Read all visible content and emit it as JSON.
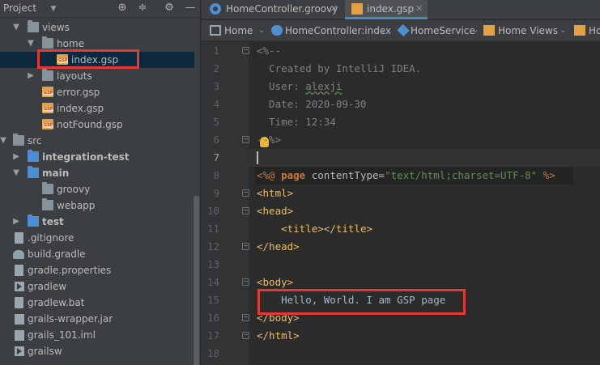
{
  "project_panel": {
    "title": "Project",
    "tree": [
      {
        "label": "views",
        "kind": "folder",
        "expanded": true
      },
      {
        "label": "home",
        "kind": "folder",
        "expanded": true
      },
      {
        "label": "index.gsp",
        "kind": "gsp",
        "selected": true,
        "highlighted": true
      },
      {
        "label": "layouts",
        "kind": "folder",
        "expanded": false
      },
      {
        "label": "error.gsp",
        "kind": "gsp"
      },
      {
        "label": "index.gsp",
        "kind": "gsp"
      },
      {
        "label": "notFound.gsp",
        "kind": "gsp"
      },
      {
        "label": "src",
        "kind": "folder",
        "expanded": true
      },
      {
        "label": "integration-test",
        "kind": "folder-src",
        "expanded": false,
        "bold": true
      },
      {
        "label": "main",
        "kind": "folder-src",
        "expanded": true,
        "bold": true
      },
      {
        "label": "groovy",
        "kind": "folder"
      },
      {
        "label": "webapp",
        "kind": "folder"
      },
      {
        "label": "test",
        "kind": "folder-src",
        "expanded": false,
        "bold": true
      },
      {
        "label": ".gitignore",
        "kind": "file"
      },
      {
        "label": "build.gradle",
        "kind": "gradle"
      },
      {
        "label": "gradle.properties",
        "kind": "file"
      },
      {
        "label": "gradlew",
        "kind": "exec"
      },
      {
        "label": "gradlew.bat",
        "kind": "file"
      },
      {
        "label": "grails-wrapper.jar",
        "kind": "jar"
      },
      {
        "label": "grails_101.iml",
        "kind": "iml"
      },
      {
        "label": "grailsw",
        "kind": "exec"
      }
    ]
  },
  "tabs": [
    {
      "label": "HomeController.groovy",
      "active": false
    },
    {
      "label": "index.gsp",
      "active": true
    }
  ],
  "breadcrumbs": [
    {
      "label": "Home"
    },
    {
      "label": "HomeController:index"
    },
    {
      "label": "HomeService"
    },
    {
      "label": "Home Views"
    },
    {
      "label": "Hom"
    }
  ],
  "line_numbers": [
    "1",
    "2",
    "3",
    "4",
    "5",
    "6",
    "7",
    "8",
    "9",
    "10",
    "11",
    "12",
    "13",
    "14",
    "15",
    "16",
    "17",
    "18"
  ],
  "code": {
    "l1": "<%--",
    "l2": "  Created by IntelliJ IDEA.",
    "l3a": "  User: ",
    "l3b": "alexji",
    "l4": "  Date: 2020-09-30",
    "l5": "  Time: 12:34",
    "l6": "--%>",
    "l8_open": "<%@ ",
    "l8_kw": "page",
    "l8_attr": " contentType=",
    "l8_val": "\"text/html;charset=UTF-8\"",
    "l8_close": " %>",
    "l9": "<html>",
    "l10": "<head>",
    "l11a": "    <title>",
    "l11b": "</title>",
    "l12": "</head>",
    "l14": "<body>",
    "l15": "    Hello, World. I am GSP page",
    "l16": "</body>",
    "l17": "</html>"
  },
  "colors": {
    "highlight_box": "#e53935",
    "selection": "#0d293e",
    "tab_underline": "#4a88c7"
  }
}
